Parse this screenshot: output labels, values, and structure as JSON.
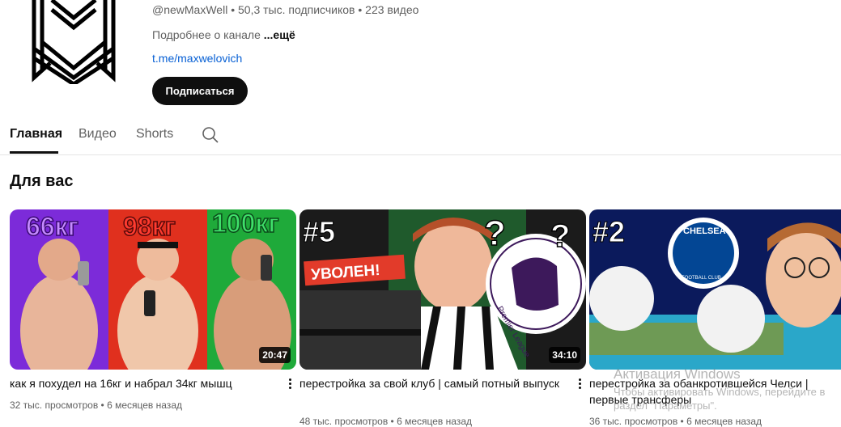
{
  "channel": {
    "handle": "@newMaxWell",
    "subscribers": "50,3 тыс. подписчиков",
    "videos_count": "223 видео",
    "separator": "•",
    "about_text": "Подробнее о канале",
    "about_more": "...ещё",
    "link": "t.me/maxwelovich",
    "subscribe_label": "Подписаться"
  },
  "tabs": [
    {
      "label": "Главная",
      "active": true
    },
    {
      "label": "Видео",
      "active": false
    },
    {
      "label": "Shorts",
      "active": false
    }
  ],
  "section": {
    "title": "Для вас"
  },
  "videos": [
    {
      "title": "как я похудел на 16кг и набрал 34кг мышц",
      "duration": "20:47",
      "views": "32 тыс. просмотров",
      "age": "6 месяцев назад",
      "thumb_text": [
        "66кг",
        "98кг",
        "100кг"
      ]
    },
    {
      "title": "перестройка за свой клуб | самый потный выпуск",
      "duration": "34:10",
      "views": "48 тыс. просмотров",
      "age": "6 месяцев назад",
      "thumb_text": [
        "#5",
        "УВОЛЕН!",
        "Premier League"
      ]
    },
    {
      "title": "перестройка за обанкротившейся Челси | первые трансферы",
      "duration": "",
      "views": "36 тыс. просмотров",
      "age": "6 месяцев назад",
      "thumb_text": [
        "#2",
        "CHELSEA",
        "FOOTBALL CLUB"
      ]
    }
  ],
  "watermark": {
    "title": "Активация Windows",
    "body": "Чтобы активировать Windows, перейдите в раздел \"Параметры\"."
  },
  "colors": {
    "accent": "#0f0f0f",
    "link": "#065fd4",
    "muted": "#606060"
  }
}
